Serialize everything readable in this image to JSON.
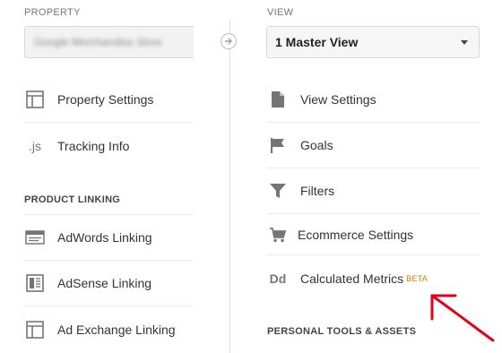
{
  "property": {
    "label": "PROPERTY",
    "selected": "Google Merchandise Store",
    "items": [
      {
        "label": "Property Settings",
        "icon": "window-icon"
      },
      {
        "label": "Tracking Info",
        "icon": "js-icon",
        "icon_text": ".js"
      }
    ],
    "section": "PRODUCT LINKING",
    "linking": [
      {
        "label": "AdWords Linking",
        "icon": "adwords-icon"
      },
      {
        "label": "AdSense Linking",
        "icon": "adsense-icon"
      },
      {
        "label": "Ad Exchange Linking",
        "icon": "window-icon"
      }
    ]
  },
  "view": {
    "label": "VIEW",
    "selected": "1 Master View",
    "items": [
      {
        "label": "View Settings",
        "icon": "document-icon"
      },
      {
        "label": "Goals",
        "icon": "flag-icon"
      },
      {
        "label": "Filters",
        "icon": "filter-icon"
      },
      {
        "label": "Ecommerce Settings",
        "icon": "cart-icon"
      },
      {
        "label": "Calculated Metrics",
        "icon": "dd-icon",
        "icon_text": "Dd",
        "badge": "BETA"
      }
    ],
    "section": "PERSONAL TOOLS & ASSETS"
  },
  "colors": {
    "badge": "#e8710a",
    "annotation_arrow": "#e3001b",
    "icon": "#757575"
  }
}
